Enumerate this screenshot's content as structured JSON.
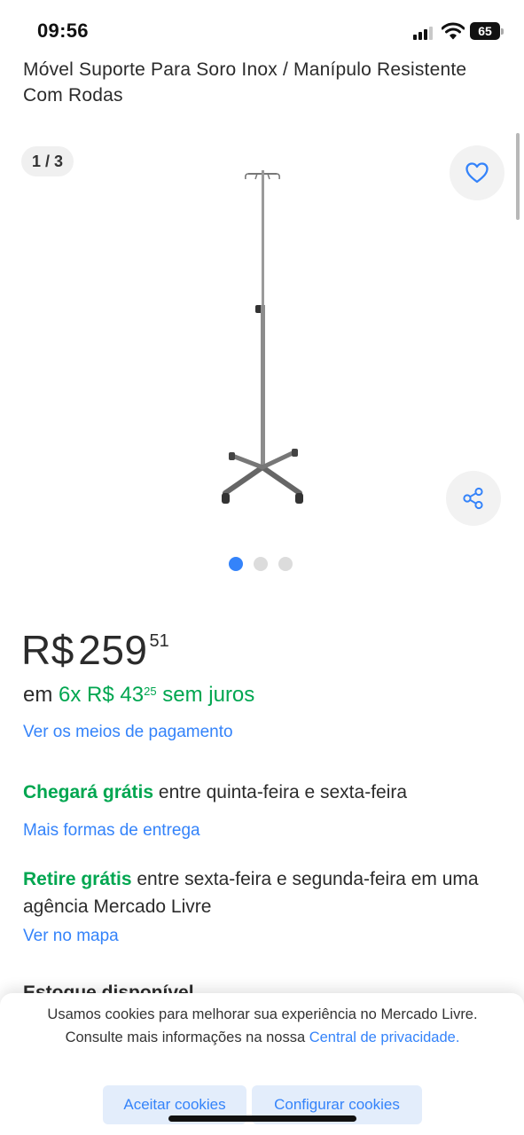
{
  "status_bar": {
    "time": "09:56",
    "battery": "65"
  },
  "product": {
    "title": "Móvel Suporte Para Soro Inox / Manípulo Resis­tente Com Rodas",
    "image_counter": "1 / 3",
    "gallery_dots": {
      "total": 3,
      "active": 1
    }
  },
  "price": {
    "currency": "R$",
    "integer": "259",
    "cents": "51",
    "installments_prefix": "em",
    "installments_count": "6x",
    "installments_currency": "R$",
    "installments_integer": "43",
    "installments_cents": "25",
    "installments_suffix": "sem juros",
    "payment_link": "Ver os meios de pagamento"
  },
  "shipping": {
    "highlight": "Chegará grátis",
    "text": " entre quinta-feira e sexta-feira",
    "link": "Mais formas de entrega"
  },
  "pickup": {
    "highlight": "Retire grátis",
    "text": " entre sexta-feira e segunda-feira em uma agência Mercado Livre",
    "link": "Ver no mapa"
  },
  "stock": {
    "label": "Estoque disponível"
  },
  "cookie_banner": {
    "text": "Usamos cookies para melhorar sua experiência no Mercado Livre. Consulte mais informações na nossa ",
    "link": "Central de privacidade.",
    "accept_label": "Aceitar cookies",
    "configure_label": "Configurar cookies"
  },
  "colors": {
    "accent_blue": "#3483fa",
    "green": "#00a650"
  },
  "icons": [
    "signal-icon",
    "wifi-icon",
    "battery-icon",
    "heart-icon",
    "share-icon"
  ]
}
